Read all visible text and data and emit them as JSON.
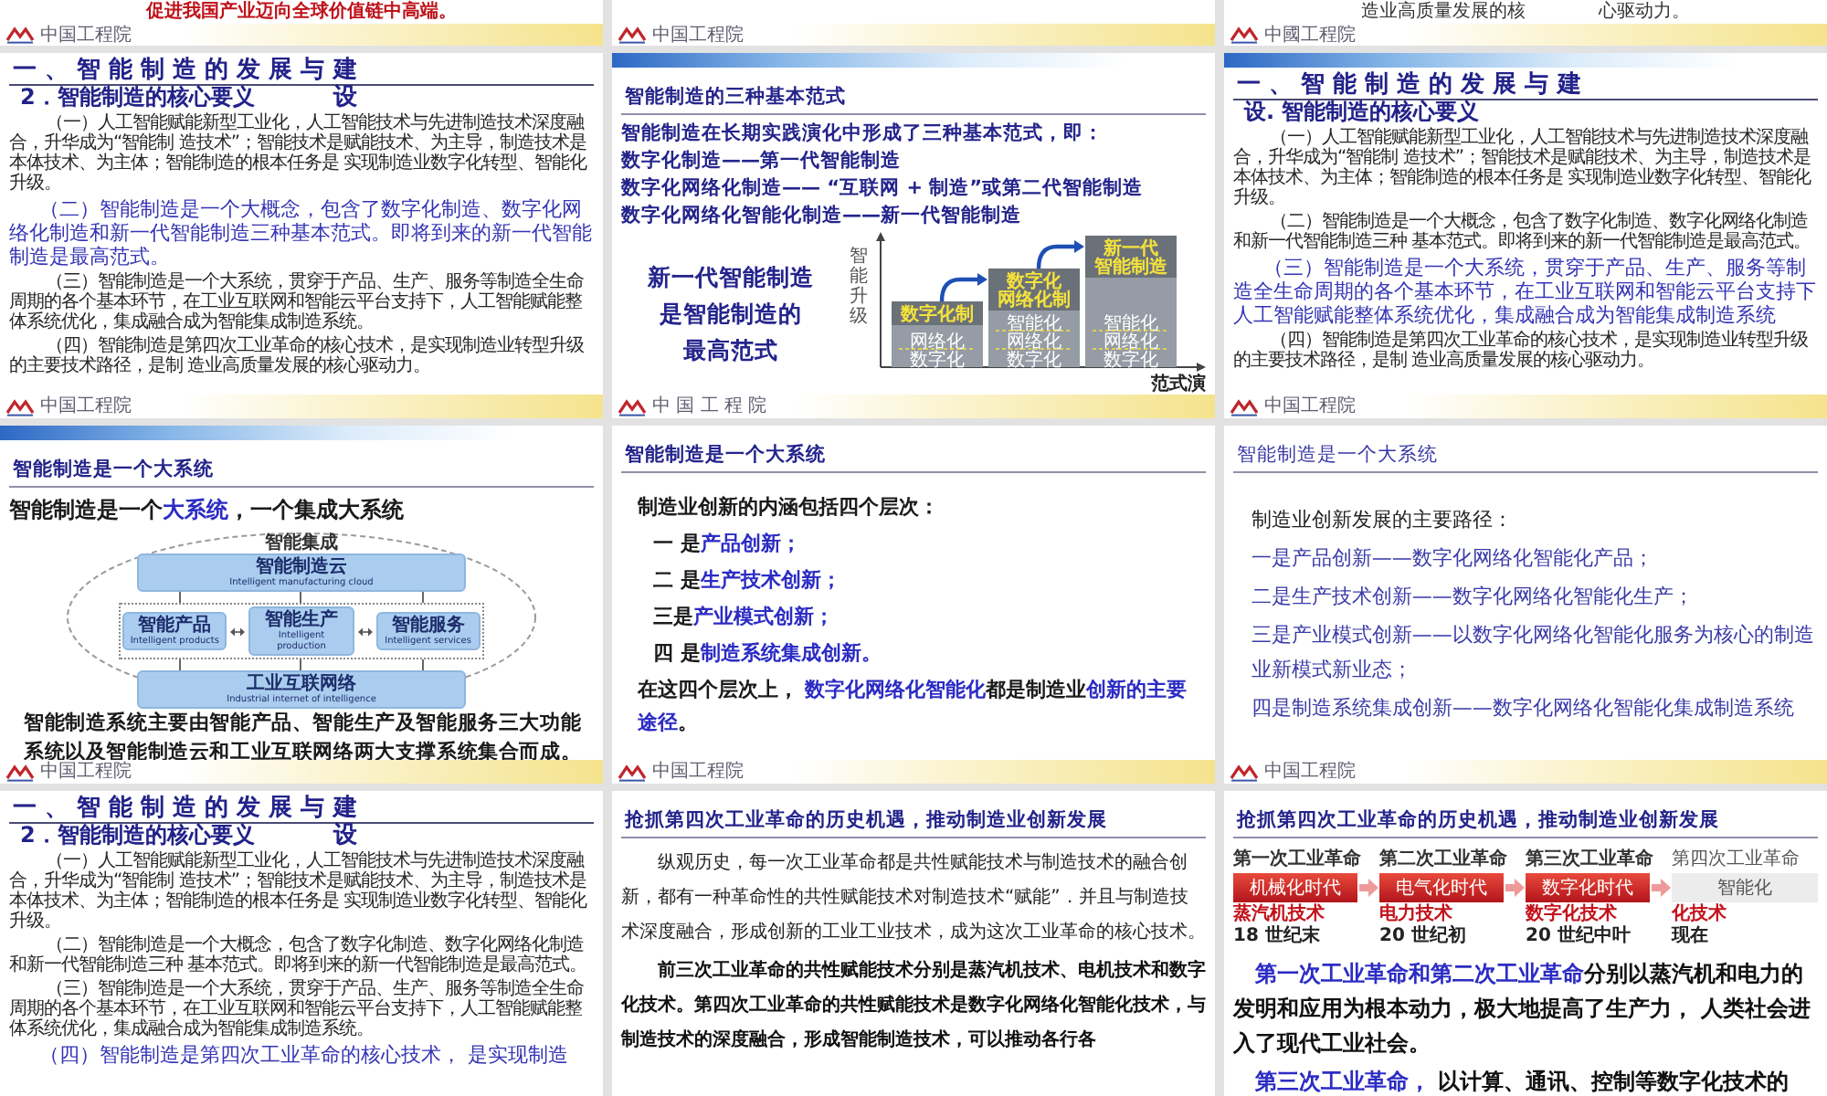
{
  "rows": [
    [
      {
        "kind": "fragment",
        "lines": [
          {
            "kind": "headline",
            "text": "促进我国产业迈向全球价值链中高端。"
          }
        ],
        "footer": {
          "logo": "中国工程院"
        }
      },
      {
        "kind": "fragment",
        "footer": {
          "logo": "中国工程院"
        }
      },
      {
        "kind": "fragment",
        "lines": [
          {
            "kind": "note",
            "text": "造业高质量发展的核"
          },
          {
            "kind": "note",
            "text": "心驱动力。"
          }
        ],
        "footer": {
          "logo": "中國工程院"
        }
      }
    ],
    [
      {
        "kind": "slide",
        "banner": false,
        "title": {
          "kind": "section",
          "text": "一 、 智 能 制 造 的 发 展 与 建",
          "subtitle": "2．智能制造的核心要义",
          "continued": "设"
        },
        "blocks": [
          {
            "kind": "note",
            "text": "（一）人工智能赋能新型工业化，人工智能技术与先进制造技术深度融合，升华成为“智能制 造技术”；智能技术是赋能技术、为主导，制造技术是本体技术、为主体；智能制造的根本任务是 实现制造业数字化转型、智能化升级。"
          },
          {
            "kind": "focus",
            "text": "（二）智能制造是一个大概念，包含了数字化制造、数字化网络化制造和新一代智能制造三种基本范式。即将到来的新一代智能制造是最高范式。"
          },
          {
            "kind": "note",
            "text": "（三）智能制造是一个大系统，贯穿于产品、生产、服务等制造全生命周期的各个基本环节，在工业互联网和智能云平台支持下，人工智能赋能整体系统优化，集成融合成为智能集成制造系统。"
          },
          {
            "kind": "note",
            "text": "（四）智能制造是第四次工业革命的核心技术，是实现制造业转型升级的主要技术路径，是制 造业高质量发展的核心驱动力。"
          }
        ],
        "footer": {
          "logo": "中国工程院"
        }
      },
      {
        "kind": "slide",
        "banner": true,
        "title": {
          "kind": "heading",
          "text": "智能制造的三种基本范式"
        },
        "blocks": [
          {
            "kind": "statement",
            "text": "智能制造在长期实践演化中形成了三种基本范式，即："
          },
          {
            "kind": "statement",
            "text": "数字化制造——第一代智能制造"
          },
          {
            "kind": "statement",
            "text": "数字化网络化制造—— “互联网 + 制造”或第二代智能制造"
          },
          {
            "kind": "statement",
            "text": "数字化网络化智能化制造——新一代智能制造"
          },
          {
            "kind": "paradigm",
            "callout": [
              "新一代智能制造",
              "是智能制造的",
              "最高范式"
            ],
            "diagram": {
              "y_label": "智能升级",
              "x_label": "范式演",
              "steps": [
                {
                  "top": [
                    "数字化制"
                  ],
                  "levels": [
                    "网络化",
                    "数字化"
                  ]
                },
                {
                  "top": [
                    "数字化",
                    "网络化制"
                  ],
                  "levels": [
                    "智能化",
                    "网络化",
                    "数字化"
                  ]
                },
                {
                  "top": [
                    "新一代",
                    "智能制造"
                  ],
                  "levels": [
                    "智能化",
                    "网络化",
                    "数字化"
                  ]
                }
              ]
            }
          }
        ],
        "footer": {
          "logo": "中 国 工 程 院"
        }
      },
      {
        "kind": "slide",
        "banner": true,
        "title": {
          "kind": "section",
          "text": "一 、 智 能 制 造 的 发 展 与 建",
          "subtitle": "设. 智能制造的核心要义"
        },
        "blocks": [
          {
            "kind": "note",
            "text": "（一）人工智能赋能新型工业化，人工智能技术与先进制造技术深度融合，升华成为“智能制 造技术”；智能技术是赋能技术、为主导，制造技术是本体技术、为主体；智能制造的根本任务是 实现制造业数字化转型、智能化升级。"
          },
          {
            "kind": "note",
            "text": "（二）智能制造是一个大概念，包含了数字化制造、数字化网络化制造和新一代智能制造三种 基本范式。即将到来的新一代智能制造是最高范式。"
          },
          {
            "kind": "focus",
            "text": "（三）智能制造是一个大系统，贯穿于产品、生产、服务等制造全生命周期的各个基本环节，在工业互联网和智能云平台支持下人工智能赋能整体系统优化，集成融合成为智能集成制造系统"
          },
          {
            "kind": "note",
            "text": "（四）智能制造是第四次工业革命的核心技术，是实现制造业转型升级的主要技术路径，是制 造业高质量发展的核心驱动力。"
          }
        ],
        "footer": {
          "logo": "中国工程院"
        }
      }
    ],
    [
      {
        "kind": "slide",
        "banner": true,
        "title": {
          "kind": "heading",
          "text": "智能制造是一个大系统"
        },
        "blocks": [
          {
            "kind": "tagline",
            "runs": [
              {
                "text": "智能制造是一个",
                "accent": false
              },
              {
                "text": "大系统",
                "accent": true
              },
              {
                "text": "，一个集成大系统",
                "accent": false
              }
            ]
          },
          {
            "kind": "system",
            "label": "智能集成",
            "cloud": {
              "name": "智能制造云",
              "caption": "Intelligent manufacturing cloud"
            },
            "modules": [
              {
                "name": "智能产品",
                "caption": "Intelligent products"
              },
              {
                "name": "智能生产",
                "caption": "Intelligent production"
              },
              {
                "name": "智能服务",
                "caption": "Intelligent services"
              }
            ],
            "network": {
              "name": "工业互联网络",
              "caption": "Industrial internet of intelligence"
            }
          },
          {
            "kind": "summary",
            "text": "智能制造系统主要由智能产品、智能生产及智能服务三大功能系统以及智能制造云和工业互联网络两大支撑系统集合而成。"
          }
        ],
        "footer": {
          "logo": "中国工程院"
        }
      },
      {
        "kind": "slide",
        "banner": false,
        "title": {
          "kind": "heading",
          "text": "智能制造是一个大系统"
        },
        "blocks": [
          {
            "kind": "line",
            "runs": [
              {
                "text": "制造业创新的内涵包括四个层次：",
                "accent": false
              }
            ]
          },
          {
            "kind": "item",
            "runs": [
              {
                "text": "一 是",
                "accent": false
              },
              {
                "text": "产品创新；",
                "accent": true
              }
            ]
          },
          {
            "kind": "item",
            "runs": [
              {
                "text": "二 是",
                "accent": false
              },
              {
                "text": "生产技术创新；",
                "accent": true
              }
            ]
          },
          {
            "kind": "item",
            "runs": [
              {
                "text": "三是",
                "accent": false
              },
              {
                "text": "产业模式创新；",
                "accent": true
              }
            ]
          },
          {
            "kind": "item",
            "runs": [
              {
                "text": "四 是",
                "accent": false
              },
              {
                "text": "制造系统集成创新。",
                "accent": true
              }
            ]
          },
          {
            "kind": "line",
            "runs": [
              {
                "text": "在这四个层次上， ",
                "accent": false
              },
              {
                "text": "数字化网络化智能化",
                "accent": true
              },
              {
                "text": "都是制造业",
                "accent": false
              },
              {
                "text": "创新的主要途径",
                "accent": true
              },
              {
                "text": "。",
                "accent": false
              }
            ]
          }
        ],
        "footer": {
          "logo": "中国工程院"
        }
      },
      {
        "kind": "slide",
        "banner": false,
        "title": {
          "kind": "light",
          "text": "智能制造是一个大系统"
        },
        "blocks": [
          {
            "kind": "route",
            "runs": [
              {
                "text": "制造业创新发展的主要路径：",
                "accent": false
              }
            ]
          },
          {
            "kind": "route",
            "runs": [
              {
                "text": "一是产品创新——数字化网络化智能化产品；",
                "accent": true
              }
            ]
          },
          {
            "kind": "route",
            "runs": [
              {
                "text": "二是生产技术创新——数字化网络化智能化生产；",
                "accent": true
              }
            ]
          },
          {
            "kind": "route",
            "runs": [
              {
                "text": "三是产业模式创新——以数字化网络化智能化服务为核心的制造业新模式新业态；",
                "accent": true
              }
            ]
          },
          {
            "kind": "route",
            "runs": [
              {
                "text": "四是制造系统集成创新——数字化网络化智能化集成制造系统",
                "accent": true
              }
            ]
          }
        ],
        "footer": {
          "logo": "中国工程院"
        }
      }
    ],
    [
      {
        "kind": "slide",
        "banner": false,
        "title": {
          "kind": "section",
          "text": "一 、 智 能 制 造 的 发 展 与 建",
          "subtitle": "2．智能制造的核心要义",
          "continued": "设"
        },
        "blocks": [
          {
            "kind": "note",
            "text": "（一）人工智能赋能新型工业化，人工智能技术与先进制造技术深度融合，升华成为“智能制 造技术”；智能技术是赋能技术、为主导，制造技术是本体技术、为主体；智能制造的根本任务是 实现制造业数字化转型、智能化升级。"
          },
          {
            "kind": "note",
            "text": "（二）智能制造是一个大概念，包含了数字化制造、数字化网络化制造和新一代智能制造三种 基本范式。即将到来的新一代智能制造是最高范式。"
          },
          {
            "kind": "note",
            "text": "（三）智能制造是一个大系统，贯穿于产品、生产、服务等制造全生命周期的各个基本环节，在工业互联网和智能云平台支持下，人工智能赋能整体系统优化，集成融合成为智能集成制造系统。"
          },
          {
            "kind": "focus",
            "text": "（四）智能制造是第四次工业革命的核心技术， 是实现制造"
          }
        ]
      },
      {
        "kind": "slide",
        "banner": false,
        "title": {
          "kind": "heading",
          "text": "抢抓第四次工业革命的历史机遇，推动制造业创新发展"
        },
        "blocks": [
          {
            "kind": "prose",
            "text": "纵观历史，每一次工业革命都是共性赋能技术与制造技术的融合创新，都有一种革命性的共性赋能技术对制造技术“赋能”．并且与制造技术深度融合，形成创新的工业工业技术，成为这次工业革命的核心技术。"
          },
          {
            "kind": "lead",
            "text": "前三次工业革命的共性赋能技术分别是蒸汽机技术、电机技术和数字化技术。第四次工业革命的共性赋能技术是数字化网络化智能化技术，与制造技术的深度融合，形成智能制造技术，可以推动各行各"
          }
        ]
      },
      {
        "kind": "slide",
        "banner": false,
        "title": {
          "kind": "heading",
          "text": "抢抓第四次工业革命的历史机遇，推动制造业创新发展"
        },
        "blocks": [
          {
            "kind": "timeline",
            "eras": [
              {
                "label": "第一次工业革命",
                "stage": "机械化时代",
                "tech": "蒸汽机技术",
                "date": "18 世纪末",
                "active": true
              },
              {
                "label": "第二次工业革命",
                "stage": "电气化时代",
                "tech": "电力技术",
                "date": "20 世纪初",
                "active": true
              },
              {
                "label": "第三次工业革命",
                "stage": "数字化时代",
                "tech": "数字化技术",
                "date": "20 世纪中叶",
                "active": true
              },
              {
                "label": "第四次工业革命",
                "stage": "智能化",
                "tech": "化技术",
                "date": "现在",
                "active": false
              }
            ]
          },
          {
            "kind": "big",
            "runs": [
              {
                "text": "第一次工业革命和第二次工业革命",
                "accent": true
              },
              {
                "text": "分别以蒸汽机和电力的发明和应用为根本动力，极大地提高了生产力， 人类社会进入了现代工业社会。",
                "accent": false
              }
            ]
          },
          {
            "kind": "big",
            "runs": [
              {
                "text": "第三次工业革命，",
                "accent": true
              },
              {
                "text": " 以计算、通讯、控制等数字化技术的",
                "accent": false
              }
            ]
          }
        ]
      }
    ]
  ]
}
